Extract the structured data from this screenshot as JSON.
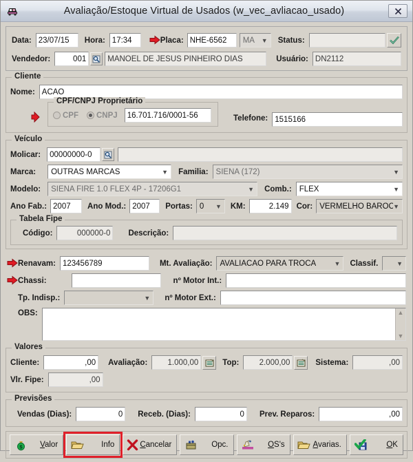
{
  "window": {
    "title": "Avaliação/Estoque Virtual de Usados (w_vec_avliacao_usado)",
    "icon": "car-icon",
    "close_label": "✕"
  },
  "header": {
    "data_label": "Data:",
    "data_value": "23/07/15",
    "hora_label": "Hora:",
    "hora_value": "17:34",
    "placa_label": "Placa:",
    "placa_value": "NHE-6562",
    "placa_uf_value": "MA",
    "status_label": "Status:",
    "status_value": "",
    "vendedor_label": "Vendedor:",
    "vendedor_code": "001",
    "vendedor_name": "MANOEL DE JESUS PINHEIRO DIAS",
    "usuario_label": "Usuário:",
    "usuario_value": "DN2112"
  },
  "cliente": {
    "legend": "Cliente",
    "nome_label": "Nome:",
    "nome_value": "ACAO",
    "doc_legend": "CPF/CNPJ Proprietário",
    "cpf_label": "CPF",
    "cnpj_label": "CNPJ",
    "doc_selected": "CNPJ",
    "doc_value": "16.701.716/0001-56",
    "telefone_label": "Telefone:",
    "telefone_value": "1515166"
  },
  "veiculo": {
    "legend": "Veículo",
    "molicar_label": "Molicar:",
    "molicar_value": "00000000-0",
    "molicar_desc": "",
    "marca_label": "Marca:",
    "marca_value": "OUTRAS MARCAS",
    "familia_label": "Familia:",
    "familia_value": "SIENA (172)",
    "modelo_label": "Modelo:",
    "modelo_value": "SIENA FIRE 1.0 FLEX 4P - 17206G1",
    "comb_label": "Comb.:",
    "comb_value": "FLEX",
    "ano_fab_label": "Ano Fab.:",
    "ano_fab_value": "2007",
    "ano_mod_label": "Ano Mod.:",
    "ano_mod_value": "2007",
    "portas_label": "Portas:",
    "portas_value": "0",
    "km_label": "KM:",
    "km_value": "2.149",
    "cor_label": "Cor:",
    "cor_value": "VERMELHO BAROCO",
    "fipe_legend": "Tabela Fipe",
    "fipe_codigo_label": "Código:",
    "fipe_codigo_value": "000000-0",
    "fipe_desc_label": "Descrição:",
    "fipe_desc_value": ""
  },
  "identificacao": {
    "renavam_label": "Renavam:",
    "renavam_value": "123456789",
    "mt_avaliacao_label": "Mt. Avaliação:",
    "mt_avaliacao_value": "AVALIACAO PARA TROCA",
    "classif_label": "Classif.",
    "classif_value": "",
    "chassi_label": "Chassi:",
    "chassi_value": "",
    "motor_int_label": "nº Motor Int.:",
    "motor_int_value": "",
    "tp_indisp_label": "Tp. Indisp.:",
    "tp_indisp_value": "",
    "motor_ext_label": "nº Motor Ext.:",
    "motor_ext_value": "",
    "obs_label": "OBS:",
    "obs_value": ""
  },
  "valores": {
    "legend": "Valores",
    "cliente_label": "Cliente:",
    "cliente_value": ",00",
    "avaliacao_label": "Avaliação:",
    "avaliacao_value": "1.000,00",
    "top_label": "Top:",
    "top_value": "2.000,00",
    "sistema_label": "Sistema:",
    "sistema_value": ",00",
    "vlr_fipe_label": "Vlr. Fipe:",
    "vlr_fipe_value": ",00"
  },
  "previsoes": {
    "legend": "Previsões",
    "vendas_label": "Vendas (Dias):",
    "vendas_value": "0",
    "receb_label": "Receb. (Dias):",
    "receb_value": "0",
    "reparos_label": "Prev. Reparos:",
    "reparos_value": ",00"
  },
  "toolbar": {
    "buttons": [
      {
        "label": "Valor",
        "icon": "money-bag-icon",
        "underline": "V",
        "highlighted": false
      },
      {
        "label": "Info",
        "icon": "folder-icon",
        "underline": "",
        "highlighted": true
      },
      {
        "label": "Cancelar",
        "icon": "red-x-icon",
        "underline": "C",
        "highlighted": false
      },
      {
        "label": "Opc.",
        "icon": "toolbox-icon",
        "underline": "",
        "highlighted": false
      },
      {
        "label": "OS's",
        "icon": "paint-icon",
        "underline": "O",
        "highlighted": false
      },
      {
        "label": "Avarias.",
        "icon": "folder-icon",
        "underline": "A",
        "highlighted": false
      },
      {
        "label": "OK",
        "icon": "check-disk-icon",
        "underline": "O",
        "highlighted": false
      }
    ]
  },
  "colors": {
    "face": "#d6d2ca",
    "accent_red": "#e0202a",
    "title_blue": "#bfc7d4"
  }
}
